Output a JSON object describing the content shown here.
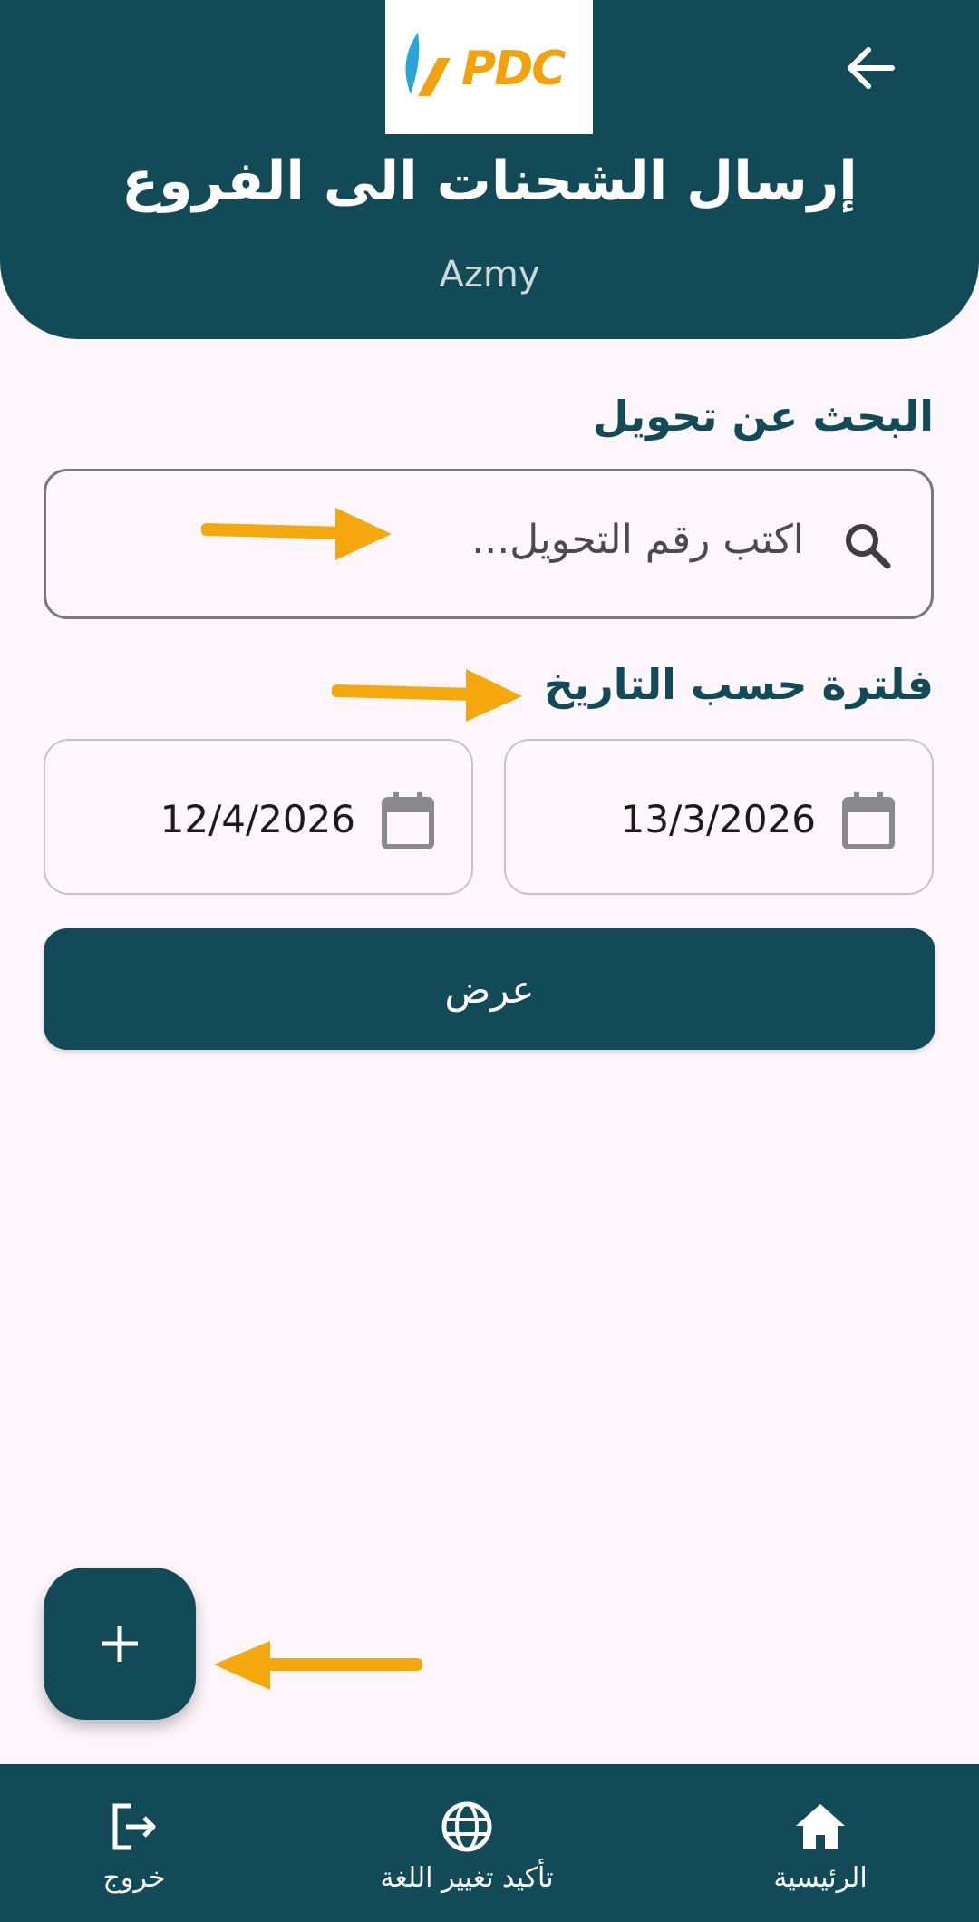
{
  "header": {
    "logo_text": "PDC",
    "title": "إرسال الشحنات الى الفروع",
    "user": "Azmy"
  },
  "search": {
    "title": "البحث عن تحويل",
    "placeholder": "اكتب رقم التحويل..."
  },
  "filter": {
    "title": "فلترة حسب التاريخ",
    "date_from": "13/3/2026",
    "date_to": "12/4/2026",
    "show_label": "عرض"
  },
  "bottom_nav": {
    "home": "الرئيسية",
    "language": "تأكيد تغيير اللغة",
    "logout": "خروج"
  },
  "colors": {
    "primary": "#124b57",
    "background": "#fdf6fb",
    "annotation_arrow": "#f5a70e",
    "logo_orange": "#f2a20f",
    "logo_blue": "#2aa6d6"
  }
}
